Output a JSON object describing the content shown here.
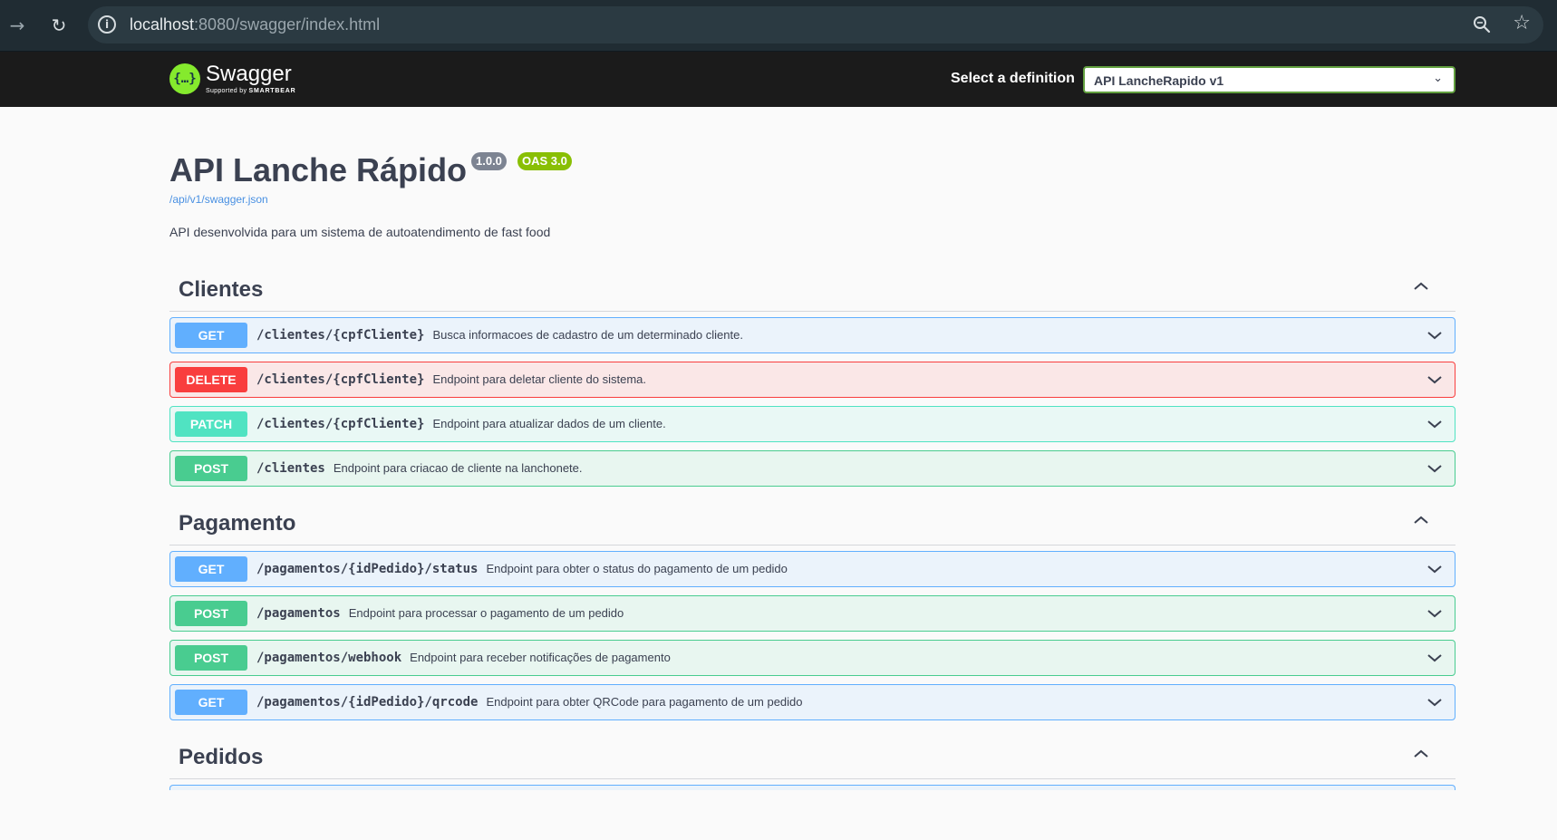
{
  "browser": {
    "url_host": "localhost",
    "url_rest": ":8080/swagger/index.html"
  },
  "topbar": {
    "logo_text": "Swagger",
    "logo_sub_prefix": "Supported by",
    "logo_sub_brand": "SMARTBEAR",
    "definition_label": "Select a definition",
    "definition_selected": "API LancheRapido v1"
  },
  "info": {
    "title": "API Lanche Rápido",
    "version_badge": "1.0.0",
    "oas_badge": "OAS 3.0",
    "spec_link": "/api/v1/swagger.json",
    "description": "API desenvolvida para um sistema de autoatendimento de fast food"
  },
  "tags": [
    {
      "name": "Clientes",
      "operations": [
        {
          "method": "GET",
          "path": "/clientes/{cpfCliente}",
          "summary": "Busca informacoes de cadastro de um determinado cliente."
        },
        {
          "method": "DELETE",
          "path": "/clientes/{cpfCliente}",
          "summary": "Endpoint para deletar cliente do sistema."
        },
        {
          "method": "PATCH",
          "path": "/clientes/{cpfCliente}",
          "summary": "Endpoint para atualizar dados de um cliente."
        },
        {
          "method": "POST",
          "path": "/clientes",
          "summary": "Endpoint para criacao de cliente na lanchonete."
        }
      ]
    },
    {
      "name": "Pagamento",
      "operations": [
        {
          "method": "GET",
          "path": "/pagamentos/{idPedido}/status",
          "summary": "Endpoint para obter o status do pagamento de um pedido"
        },
        {
          "method": "POST",
          "path": "/pagamentos",
          "summary": "Endpoint para processar o pagamento de um pedido"
        },
        {
          "method": "POST",
          "path": "/pagamentos/webhook",
          "summary": "Endpoint para receber notificações de pagamento"
        },
        {
          "method": "GET",
          "path": "/pagamentos/{idPedido}/qrcode",
          "summary": "Endpoint para obter QRCode para pagamento de um pedido"
        }
      ]
    },
    {
      "name": "Pedidos",
      "operations": []
    }
  ],
  "colors": {
    "get": "#61affe",
    "delete": "#f93e3e",
    "patch": "#50e3c2",
    "post": "#49cc90",
    "topbar": "#1b1b1b",
    "accent_green": "#85ea2d"
  },
  "icons": {
    "back": "arrow-right-icon",
    "reload": "reload-icon",
    "info": "info-icon",
    "zoom": "zoom-icon",
    "bookmark": "star-icon",
    "tag_toggle": "chevron-up-icon",
    "op_toggle": "chevron-down-icon"
  }
}
